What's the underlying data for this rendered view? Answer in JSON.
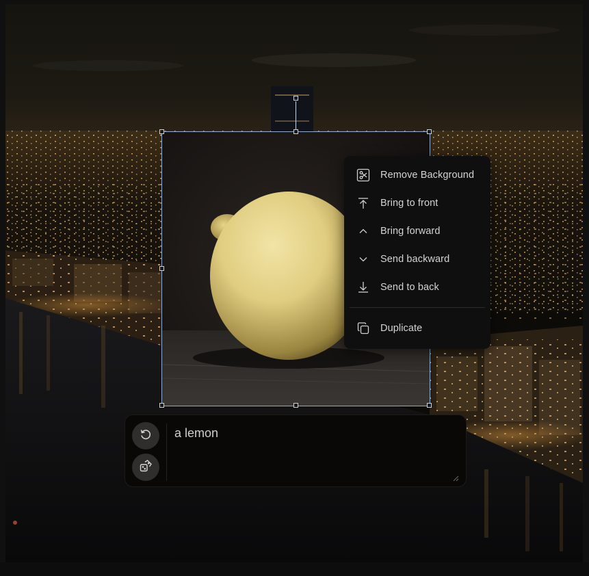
{
  "context_menu": {
    "items": [
      {
        "label": "Remove Background",
        "icon": "scissors-icon"
      },
      {
        "label": "Bring to front",
        "icon": "arrow-up-to-line-icon"
      },
      {
        "label": "Bring forward",
        "icon": "chevron-up-icon"
      },
      {
        "label": "Send backward",
        "icon": "chevron-down-icon"
      },
      {
        "label": "Send to back",
        "icon": "arrow-down-to-line-icon"
      }
    ],
    "duplicate": {
      "label": "Duplicate",
      "icon": "copy-icon"
    }
  },
  "prompt": {
    "value": "a lemon",
    "tools": [
      {
        "icon": "regenerate-icon"
      },
      {
        "icon": "dice-icon"
      }
    ]
  },
  "colors": {
    "selection": "#8fa8cc",
    "menu_bg": "#0f0f0f",
    "menu_text": "#d4d4d4",
    "prompt_bg": "#090806",
    "lemon": "#e6d48a"
  }
}
